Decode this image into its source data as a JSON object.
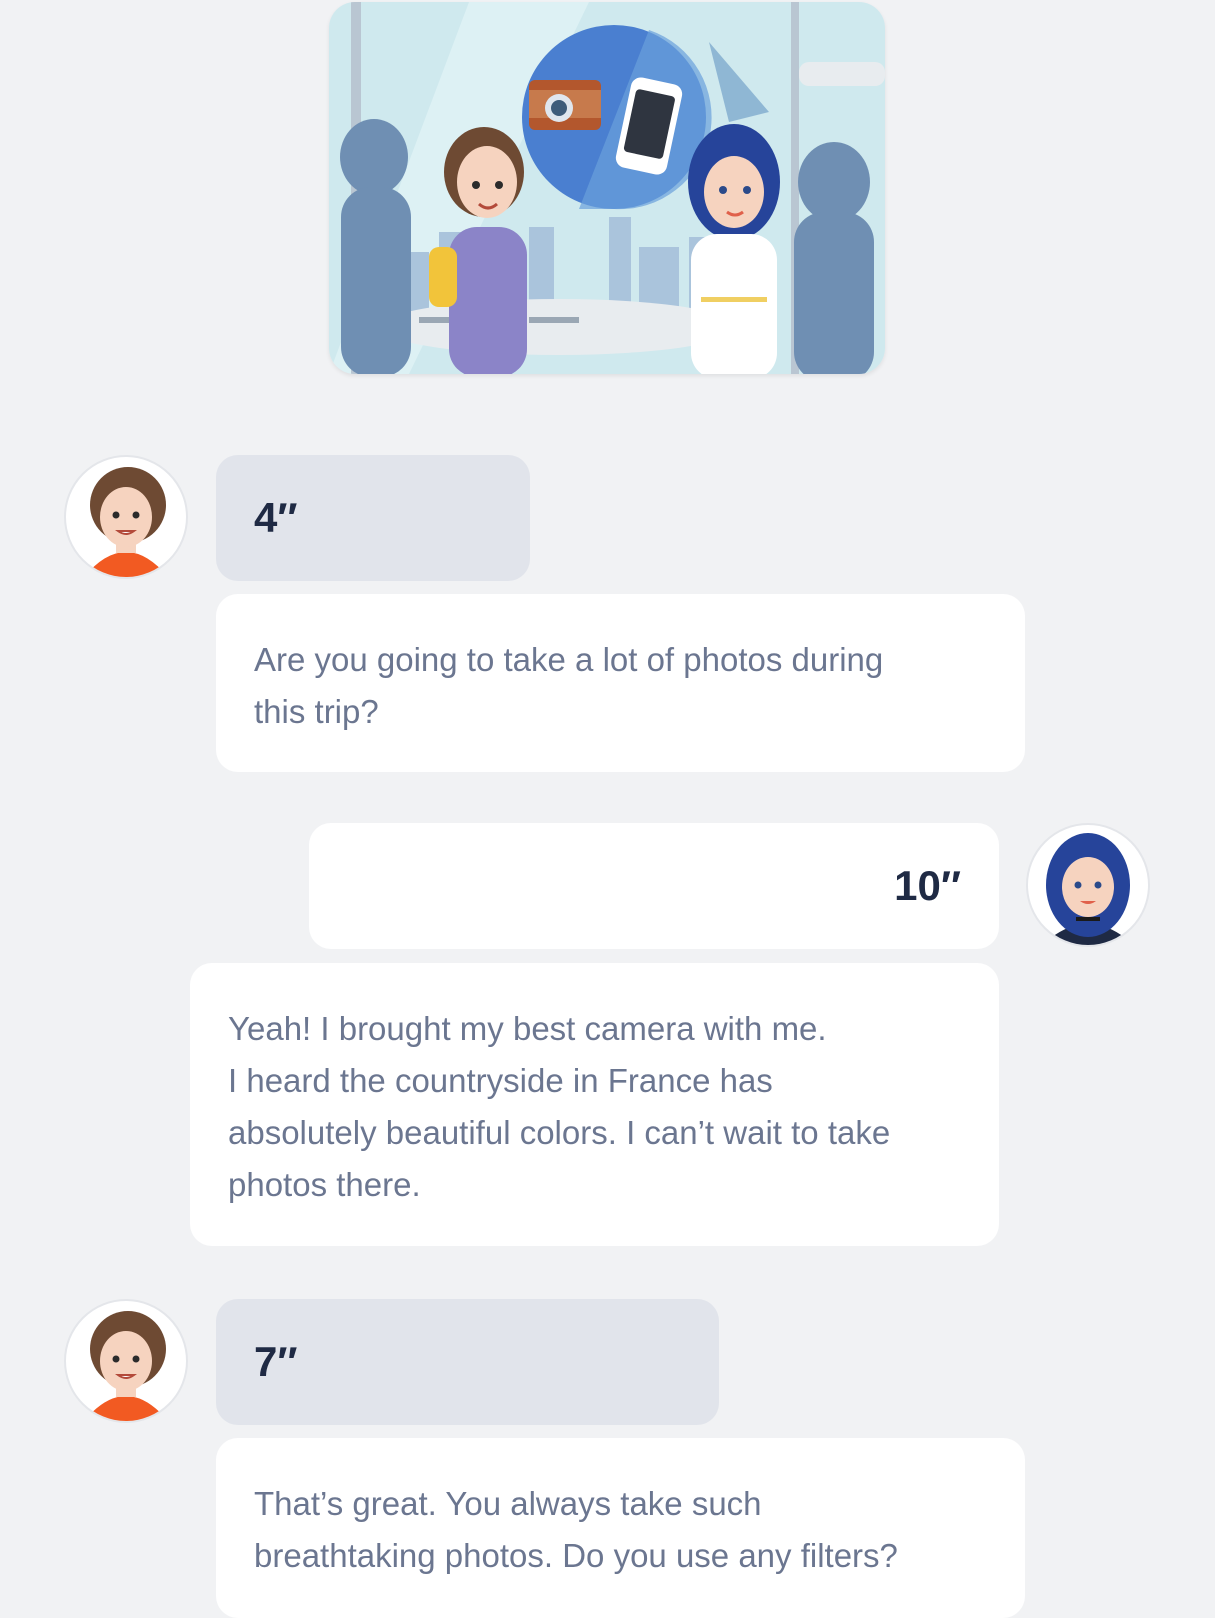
{
  "illustration": {
    "name": "airport-scene",
    "colors": {
      "sky": "#cfe9ee",
      "circle": "#4a7fd0",
      "silhouette": "#6f8fb3"
    }
  },
  "conversation": [
    {
      "speaker": "left",
      "avatar": "brown-haired-woman-avatar",
      "duration": "4″",
      "text_lines": [
        "Are you going to take a lot of photos during",
        "this trip?"
      ]
    },
    {
      "speaker": "right",
      "avatar": "blue-haired-woman-avatar",
      "duration": "10″",
      "text_lines": [
        "Yeah! I brought my best camera with me.",
        "I heard the countryside in France has",
        "absolutely beautiful colors. I can’t wait to take",
        "photos there."
      ]
    },
    {
      "speaker": "left",
      "avatar": "brown-haired-woman-avatar",
      "duration": "7″",
      "text_lines": [
        "That’s great. You always take such",
        "breathtaking photos. Do you use any filters?"
      ]
    }
  ],
  "colors": {
    "page_background": "#f1f2f4",
    "duration_bubble": "#e1e4eb",
    "message_bubble": "#ffffff",
    "duration_text": "#1f2a44",
    "message_text": "#6b7690"
  }
}
